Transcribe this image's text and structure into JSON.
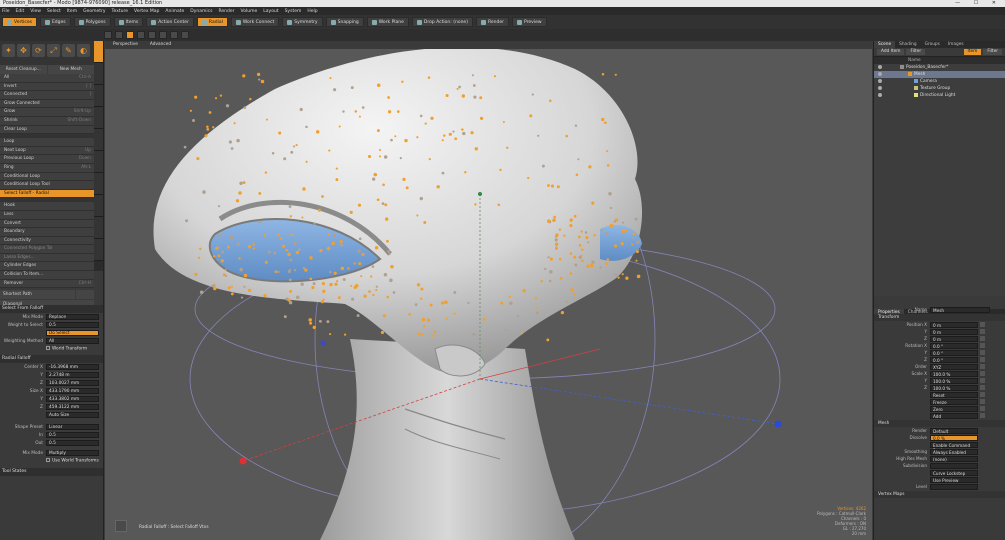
{
  "window": {
    "title": "Poseidon_Basecfer* - Modo [9874-976090] release_16.1 Edition",
    "controls": "— ☐ ✕"
  },
  "menu": [
    "File",
    "Edit",
    "View",
    "Select",
    "Item",
    "Geometry",
    "Texture",
    "Vertex Map",
    "Animate",
    "Dynamics",
    "Render",
    "Volume",
    "Layout",
    "System",
    "Help"
  ],
  "toolbar": {
    "buttons": [
      {
        "label": "Vertices",
        "active": true
      },
      {
        "label": "Edges",
        "active": false
      },
      {
        "label": "Polygons",
        "active": false
      },
      {
        "label": "Items",
        "active": false
      },
      {
        "label": "Action Center",
        "active": false
      },
      {
        "label": "Radial",
        "active": true
      },
      {
        "label": "Work Connect",
        "active": false
      },
      {
        "label": "Symmetry",
        "active": false
      },
      {
        "label": "Snapping",
        "active": false
      },
      {
        "label": "Work Plane",
        "active": false
      },
      {
        "label": "Drop Action: (none)",
        "active": false
      },
      {
        "label": "Render",
        "active": false
      },
      {
        "label": "Preview",
        "active": false
      }
    ]
  },
  "left_panel": {
    "clear_buttons": [
      "Reset Cleanup...",
      "New Mesh"
    ],
    "rows": [
      {
        "label": "All",
        "short": "Ctrl-A"
      },
      {
        "label": "Invert",
        "short": "[ ]"
      },
      {
        "label": "Connected",
        "short": "]"
      },
      {
        "label": "Grow Connected",
        "short": ""
      },
      {
        "label": "Grow",
        "short": "Shift-Up"
      },
      {
        "label": "Shrink",
        "short": "Shift-Down"
      },
      {
        "label": "Clear Loop",
        "short": ""
      },
      {
        "gap": true
      },
      {
        "label": "Loop",
        "short": ""
      },
      {
        "label": "Next Loop",
        "short": "Up"
      },
      {
        "label": "Previous Loop",
        "short": "Down"
      },
      {
        "label": "Ring",
        "short": "Alt-L"
      },
      {
        "label": "Conditional Loop",
        "short": ""
      },
      {
        "label": "Conditional Loop Tool",
        "short": ""
      },
      {
        "label": "Select Falloff - Radial",
        "short": "",
        "sel": true
      },
      {
        "gap": true
      },
      {
        "label": "Hook",
        "short": ""
      },
      {
        "label": "Less",
        "short": ""
      },
      {
        "label": "Convert",
        "short": ""
      },
      {
        "label": "Boundary",
        "short": ""
      },
      {
        "label": "Connectivity",
        "short": ""
      },
      {
        "label": "Connected Polygon Tol",
        "short": "",
        "dim": true
      },
      {
        "label": "Lasso Edges...",
        "short": "",
        "dim": true
      },
      {
        "label": "Cylinder Edges",
        "short": ""
      },
      {
        "label": "Collision To Item...",
        "short": ""
      },
      {
        "label": "Remover",
        "short": "Ctrl-H"
      }
    ],
    "shortest_path": "Shortest Path",
    "diagonal": "Diagonal",
    "select_from_falloff": {
      "title": "Select From Falloff",
      "mix_mode_label": "Mix Mode",
      "mix_mode": "Replace",
      "weight_label": "Weight to Select",
      "weight": "0.5",
      "do_select": "Do Select",
      "weighting_label": "Weighting Method",
      "weighting": "All",
      "world_transform": "World Transform"
    },
    "radial_falloff": {
      "title": "Radial Falloff",
      "center_label": "Center X",
      "center": [
        "-16.3968 mm",
        "2.2748 m",
        "103.0027 mm"
      ],
      "size_label": "Size X",
      "size": [
        "433.1790 mm",
        "433.3802 mm",
        "459.3122 mm"
      ],
      "auto_size": "Auto Size",
      "shape_label": "Shape Preset",
      "shape": "Linear",
      "in_label": "In",
      "in_val": "0.5",
      "out_label": "Out",
      "out_val": "0.5",
      "mix_label": "Mix Mode",
      "mix": "Multiply",
      "use_world": "Use World Transforms"
    },
    "tool_states": "Tool States"
  },
  "viewport": {
    "view_name": "Perspective",
    "shading": "Advanced",
    "bottom_label": "Radial Falloff : Select Falloff Vtxs",
    "info": {
      "mode": "Vertices: 4262",
      "lines": [
        "Polygons : Catmull-Clark",
        "Channels : 0",
        "Deformers : ON",
        "GL : 27,270",
        "20 mm"
      ]
    }
  },
  "right_panel": {
    "top_tabs": [
      "Scene",
      "Shading",
      "Groups",
      "Images"
    ],
    "bar_buttons": [
      "Add Item",
      "Filter",
      "Item",
      "Filter"
    ],
    "outliner": {
      "header": "Name",
      "items": [
        {
          "label": "Poseidon_Basecfer*",
          "indent": 14,
          "icon": "#8f8f8f",
          "sel": false
        },
        {
          "label": "Mesh",
          "indent": 22,
          "icon": "#e8962a",
          "sel": true
        },
        {
          "label": "Camera",
          "indent": 28,
          "icon": "#6fa1d8",
          "sel": false
        },
        {
          "label": "Texture Group",
          "indent": 28,
          "icon": "#c9c17a",
          "sel": false
        },
        {
          "label": "Directional Light",
          "indent": 28,
          "icon": "#e2e27a",
          "sel": false
        }
      ]
    },
    "prop_tabs": [
      "Properties",
      "Channels",
      "Info",
      "Stats"
    ],
    "name_label": "Name",
    "name_value": "Mesh",
    "transform_title": "Transform",
    "transform": [
      {
        "label": "Position X",
        "value": "0 m"
      },
      {
        "label": "Y",
        "value": "0 m"
      },
      {
        "label": "Z",
        "value": "0 m"
      },
      {
        "label": "Rotation X",
        "value": "0.0 °"
      },
      {
        "label": "Y",
        "value": "0.0 °"
      },
      {
        "label": "Z",
        "value": "0.0 °"
      },
      {
        "label": "Order",
        "value": "XYZ"
      },
      {
        "label": "Scale X",
        "value": "100.0 %"
      },
      {
        "label": "Y",
        "value": "100.0 %"
      },
      {
        "label": "Z",
        "value": "100.0 %"
      },
      {
        "label": "",
        "value": "Reset"
      },
      {
        "label": "",
        "value": "Freeze"
      },
      {
        "label": "",
        "value": "Zero"
      },
      {
        "label": "",
        "value": "Add"
      }
    ],
    "mesh_title": "Mesh",
    "mesh": [
      {
        "label": "Render",
        "value": "Default",
        "org": false
      },
      {
        "label": "Dissolve",
        "value": "0.0 %",
        "org": true
      },
      {
        "label": "",
        "value": "Enable Command Regi...",
        "org": false
      },
      {
        "label": "Smoothing",
        "value": "Always Enabled",
        "org": false
      },
      {
        "label": "High Res Mesh",
        "value": "(none)",
        "org": false
      },
      {
        "label": "Subdivision",
        "value": "",
        "org": false
      },
      {
        "label": "",
        "value": "Curve Lockstep",
        "org": false
      },
      {
        "label": "",
        "value": "Use Preview",
        "org": false
      },
      {
        "label": "Level",
        "value": "",
        "org": false
      }
    ],
    "vertex_maps": "Vertex Maps"
  }
}
